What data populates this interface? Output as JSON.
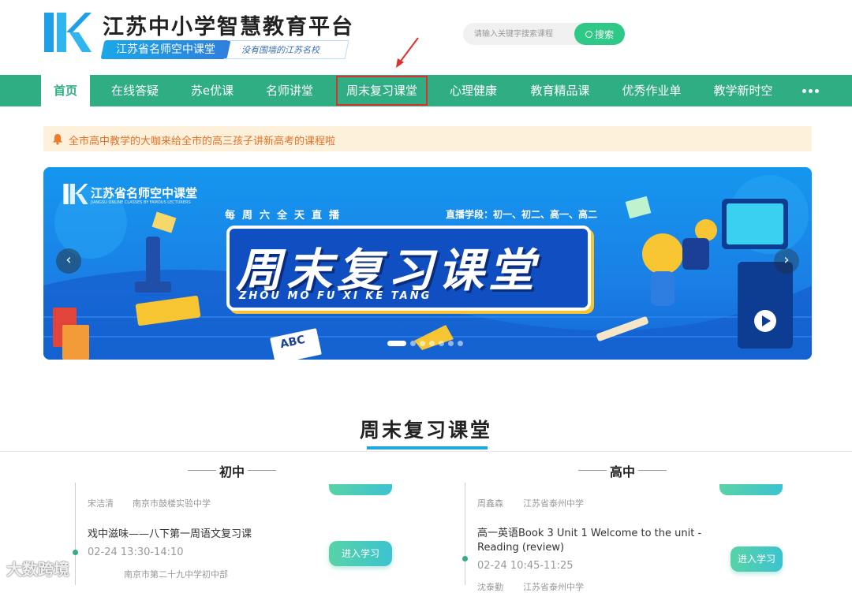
{
  "header": {
    "site_title": "江苏中小学智慧教育平台",
    "sub_badge": "江苏省名师空中课堂",
    "slogan": "没有围墙的江苏名校",
    "search": {
      "placeholder": "请输入关键字搜索课程",
      "button_label": "搜索"
    }
  },
  "nav": {
    "items": [
      {
        "label": "首页"
      },
      {
        "label": "在线答疑"
      },
      {
        "label": "苏e优课"
      },
      {
        "label": "名师讲堂"
      },
      {
        "label": "周末复习课堂"
      },
      {
        "label": "心理健康"
      },
      {
        "label": "教育精品课"
      },
      {
        "label": "优秀作业单"
      },
      {
        "label": "教学新时空"
      }
    ],
    "active_index": 0,
    "highlighted_index": 4,
    "more_icon": "more-dots-icon"
  },
  "notice": {
    "text": "全市高中教学的大咖来给全市的高三孩子讲新高考的课程啦"
  },
  "banner": {
    "logo_text": "江苏省名师空中课堂",
    "logo_en": "JIANGSU ONLINE CLASSES BY FAMOUS LECTURERS",
    "tagline": "每周六全天直播",
    "grades": "直播学段：初一、初二、高一、高二",
    "title": "周末复习课堂",
    "pinyin": "ZHOU MO FU XI KE TANG",
    "book_label": "ABC",
    "slide_count": 7,
    "active_slide": 0
  },
  "section": {
    "title": "周末复习课堂"
  },
  "columns": {
    "junior": {
      "heading": "初中",
      "items": [
        {
          "teacher": "宋洁清",
          "school": "南京市鼓楼实验中学"
        },
        {
          "title": "戏中滋味——八下第一周语文复习课",
          "time": "02-24 13:30-14:10",
          "teacher": "",
          "school": "南京市第二十九中学初中部",
          "button": "进入学习"
        }
      ]
    },
    "senior": {
      "heading": "高中",
      "items": [
        {
          "teacher": "周鑫森",
          "school": "江苏省泰州中学"
        },
        {
          "title": "高一英语Book 3 Unit 1 Welcome to the unit - Reading (review)",
          "time": "02-24 10:45-11:25",
          "teacher": "沈泰勤",
          "school": "江苏省泰州中学",
          "button": "进入学习"
        }
      ]
    }
  },
  "watermark": "大数跨境",
  "colors": {
    "nav_green": "#2fae84",
    "accent_blue": "#1fa8e0",
    "search_green": "#2ec986",
    "notice_bg": "#fdf1dc",
    "highlight_red": "#d9322c"
  }
}
